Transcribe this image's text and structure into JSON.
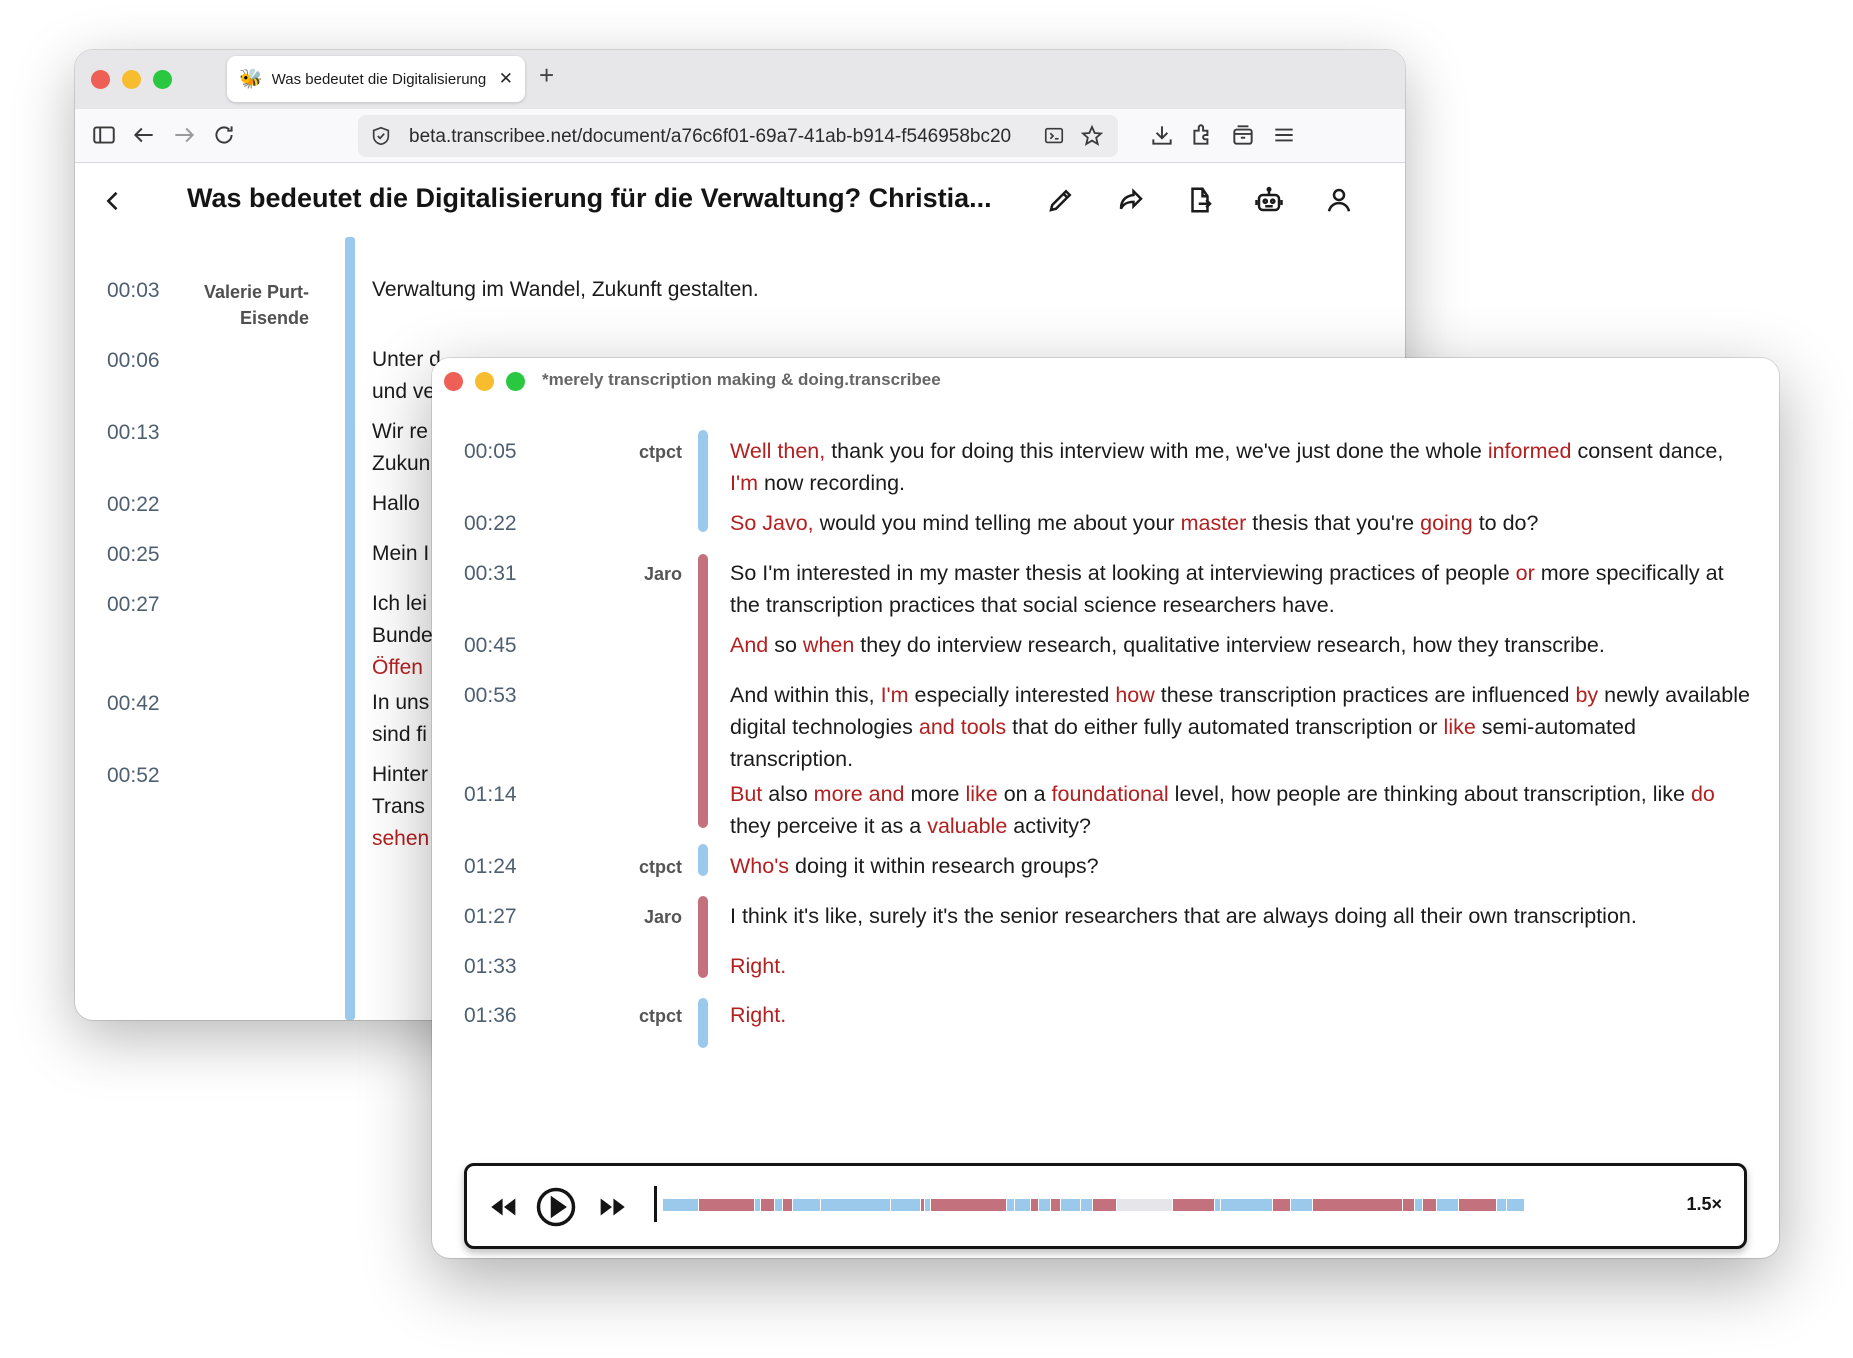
{
  "browser": {
    "tab_title": "Was bedeutet die Digitalisierung",
    "tab_favicon": "🐝",
    "tab_close": "✕",
    "new_tab": "+",
    "url": "beta.transcribee.net/document/a76c6f01-69a7-41ab-b914-f546958bc20",
    "icons": [
      "sidebar-icon",
      "back-arrow-icon",
      "forward-arrow-icon",
      "reload-icon",
      "shield-icon",
      "reader-icon",
      "star-icon",
      "download-icon",
      "extensions-icon",
      "container-icon",
      "menu-icon"
    ]
  },
  "doc_header": {
    "title": "Was bedeutet die Digitalisierung für die Verwaltung?  Christia...",
    "icons": [
      "chevron-left-icon",
      "pencil-icon",
      "share-icon",
      "export-icon",
      "robot-icon",
      "user-icon"
    ]
  },
  "back_transcript": {
    "segments": [
      {
        "time": "00:03",
        "speaker": [
          "Valerie Purt-",
          "Eisende"
        ],
        "lines": [
          [
            {
              "t": "Verwaltung im Wandel, Zukunft gestalten."
            }
          ]
        ]
      },
      {
        "time": "00:06",
        "speaker": [],
        "lines": [
          [
            {
              "t": "Unter d"
            }
          ],
          [
            {
              "t": "und ve"
            }
          ]
        ]
      },
      {
        "time": "00:13",
        "speaker": [],
        "lines": [
          [
            {
              "t": "Wir re"
            }
          ],
          [
            {
              "t": "Zukun"
            }
          ]
        ]
      },
      {
        "time": "00:22",
        "speaker": [],
        "lines": [
          [
            {
              "t": "Hallo"
            }
          ]
        ]
      },
      {
        "time": "00:25",
        "speaker": [],
        "lines": [
          [
            {
              "t": "Mein I"
            }
          ]
        ]
      },
      {
        "time": "00:27",
        "speaker": [],
        "lines": [
          [
            {
              "t": "Ich lei"
            }
          ],
          [
            {
              "t": "Bunde"
            }
          ],
          [
            {
              "t": "Öffen",
              "h": true
            }
          ]
        ]
      },
      {
        "time": "00:42",
        "speaker": [],
        "lines": [
          [
            {
              "t": "In uns"
            }
          ],
          [
            {
              "t": "sind fi"
            }
          ]
        ]
      },
      {
        "time": "00:52",
        "speaker": [],
        "lines": [
          [
            {
              "t": "Hinter"
            }
          ],
          [
            {
              "t": "Trans"
            }
          ],
          [
            {
              "t": "sehen",
              "h": true
            }
          ]
        ]
      }
    ]
  },
  "app": {
    "window_title": "*merely transcription making & doing.transcribee",
    "segments": [
      {
        "time": "00:05",
        "speaker": "ctpct",
        "color": "blue",
        "paragraphs": [
          [
            {
              "t": "Well then,",
              "h": true
            },
            {
              "t": " thank you for doing this interview with me, we've just done the whole "
            },
            {
              "t": "informed",
              "h": true
            },
            {
              "t": " consent dance, "
            },
            {
              "t": "I'm",
              "h": true
            },
            {
              "t": " now recording."
            }
          ]
        ]
      },
      {
        "time": "00:22",
        "speaker": "",
        "color": "blue",
        "paragraphs": [
          [
            {
              "t": "So Javo,",
              "h": true
            },
            {
              "t": " would you mind telling me about your "
            },
            {
              "t": "master",
              "h": true
            },
            {
              "t": " thesis that you're "
            },
            {
              "t": "going",
              "h": true
            },
            {
              "t": " to do?"
            }
          ]
        ]
      },
      {
        "time": "00:31",
        "speaker": "Jaro",
        "color": "red",
        "paragraphs": [
          [
            {
              "t": "So I'm interested in my master thesis at looking at interviewing practices of people "
            },
            {
              "t": "or",
              "h": true
            },
            {
              "t": " more specifically at the transcription practices that social science researchers have."
            }
          ]
        ]
      },
      {
        "time": "00:45",
        "speaker": "",
        "color": "red",
        "paragraphs": [
          [
            {
              "t": "And",
              "h": true
            },
            {
              "t": " so "
            },
            {
              "t": "when",
              "h": true
            },
            {
              "t": " they do interview research, qualitative interview research, how they transcribe."
            }
          ]
        ]
      },
      {
        "time": "00:53",
        "speaker": "",
        "color": "red",
        "paragraphs": [
          [
            {
              "t": "And within this, "
            },
            {
              "t": "I'm",
              "h": true
            },
            {
              "t": " especially interested "
            },
            {
              "t": "how",
              "h": true
            },
            {
              "t": " these transcription practices are influenced "
            },
            {
              "t": "by",
              "h": true
            },
            {
              "t": " newly available digital technologies "
            },
            {
              "t": "and",
              "h": true
            },
            {
              "t": " "
            },
            {
              "t": "tools",
              "h": true
            },
            {
              "t": " that do either fully automated transcription or "
            },
            {
              "t": "like",
              "h": true
            },
            {
              "t": " semi-automated transcription."
            }
          ]
        ]
      },
      {
        "time": "01:14",
        "speaker": "",
        "color": "red",
        "paragraphs": [
          [
            {
              "t": "But",
              "h": true
            },
            {
              "t": " also "
            },
            {
              "t": "more",
              "h": true
            },
            {
              "t": " "
            },
            {
              "t": "and",
              "h": true
            },
            {
              "t": " more "
            },
            {
              "t": "like",
              "h": true
            },
            {
              "t": " on a "
            },
            {
              "t": "foundational",
              "h": true
            },
            {
              "t": " level, how people are thinking about transcription, like "
            },
            {
              "t": "do",
              "h": true
            },
            {
              "t": " they perceive it as a "
            },
            {
              "t": "valuable",
              "h": true
            },
            {
              "t": " activity?"
            }
          ]
        ]
      },
      {
        "time": "01:24",
        "speaker": "ctpct",
        "color": "blue",
        "paragraphs": [
          [
            {
              "t": "Who's",
              "h": true
            },
            {
              "t": " doing it within research groups?"
            }
          ]
        ]
      },
      {
        "time": "01:27",
        "speaker": "Jaro",
        "color": "red",
        "paragraphs": [
          [
            {
              "t": "I think it's like, surely it's the senior researchers that are always doing all their own transcription."
            }
          ]
        ]
      },
      {
        "time": "01:33",
        "speaker": "",
        "color": "red",
        "paragraphs": [
          [
            {
              "t": "Right.",
              "h": true
            }
          ]
        ]
      },
      {
        "time": "01:36",
        "speaker": "ctpct",
        "color": "blue",
        "paragraphs": [
          [
            {
              "t": "Right.",
              "h": true
            }
          ]
        ]
      }
    ],
    "player": {
      "rate": "1.5×",
      "icons": [
        "rewind-icon",
        "play-icon",
        "fast-forward-icon"
      ]
    }
  },
  "colors": {
    "highlight": "#b42020",
    "speaker_blue": "#9ac9ec",
    "speaker_red": "#c4717e",
    "time_text": "#4d5f70"
  }
}
